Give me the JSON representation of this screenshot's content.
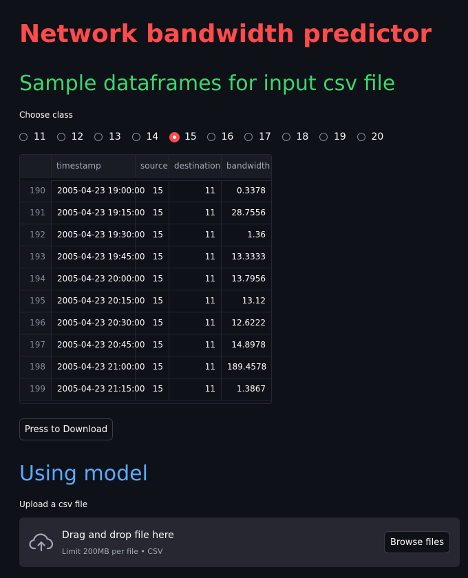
{
  "page": {
    "title": "Network bandwidth predictor",
    "section1_heading": "Sample dataframes for input csv file",
    "section2_heading": "Using model"
  },
  "radio": {
    "label": "Choose class",
    "options": [
      "11",
      "12",
      "13",
      "14",
      "15",
      "16",
      "17",
      "18",
      "19",
      "20"
    ],
    "selected": "15"
  },
  "table": {
    "columns": [
      "",
      "timestamp",
      "source",
      "destination",
      "bandwidth"
    ],
    "rows": [
      {
        "index": "190",
        "timestamp": "2005-04-23 19:00:00",
        "source": "15",
        "destination": "11",
        "bandwidth": "0.3378"
      },
      {
        "index": "191",
        "timestamp": "2005-04-23 19:15:00",
        "source": "15",
        "destination": "11",
        "bandwidth": "28.7556"
      },
      {
        "index": "192",
        "timestamp": "2005-04-23 19:30:00",
        "source": "15",
        "destination": "11",
        "bandwidth": "1.36"
      },
      {
        "index": "193",
        "timestamp": "2005-04-23 19:45:00",
        "source": "15",
        "destination": "11",
        "bandwidth": "13.3333"
      },
      {
        "index": "194",
        "timestamp": "2005-04-23 20:00:00",
        "source": "15",
        "destination": "11",
        "bandwidth": "13.7956"
      },
      {
        "index": "195",
        "timestamp": "2005-04-23 20:15:00",
        "source": "15",
        "destination": "11",
        "bandwidth": "13.12"
      },
      {
        "index": "196",
        "timestamp": "2005-04-23 20:30:00",
        "source": "15",
        "destination": "11",
        "bandwidth": "12.6222"
      },
      {
        "index": "197",
        "timestamp": "2005-04-23 20:45:00",
        "source": "15",
        "destination": "11",
        "bandwidth": "14.8978"
      },
      {
        "index": "198",
        "timestamp": "2005-04-23 21:00:00",
        "source": "15",
        "destination": "11",
        "bandwidth": "189.4578"
      },
      {
        "index": "199",
        "timestamp": "2005-04-23 21:15:00",
        "source": "15",
        "destination": "11",
        "bandwidth": "1.3867"
      }
    ]
  },
  "download_button": {
    "label": "Press to Download"
  },
  "uploader": {
    "label": "Upload a csv file",
    "drop_text": "Drag and drop file here",
    "limit_text": "Limit 200MB per file • CSV",
    "browse_label": "Browse files",
    "icon": "cloud-upload-icon"
  },
  "colors": {
    "background": "#0e1117",
    "title": "#ff4b4b",
    "section1": "#3dd56d",
    "section2": "#5aabff",
    "accent": "#ff4b4b"
  }
}
